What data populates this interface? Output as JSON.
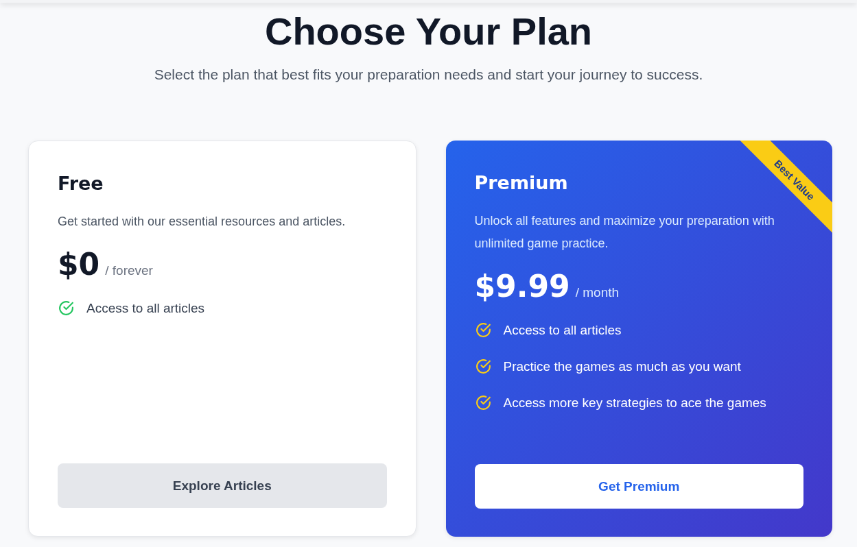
{
  "heading": "Choose Your Plan",
  "subheading": "Select the plan that best fits your preparation needs and start your journey to success.",
  "plans": [
    {
      "name": "Free",
      "featured": false,
      "description": "Get started with our essential resources and articles.",
      "price": "$0",
      "period": "/ forever",
      "features": [
        "Access to all articles"
      ],
      "button": "Explore Articles"
    },
    {
      "name": "Premium",
      "featured": true,
      "ribbon": "Best Value",
      "description": "Unlock all features and maximize your preparation with unlimited game practice.",
      "price": "$9.99",
      "period": "/ month",
      "features": [
        "Access to all articles",
        "Practice the games as much as you want",
        "Access more key strategies to ace the games"
      ],
      "button": "Get Premium"
    }
  ]
}
